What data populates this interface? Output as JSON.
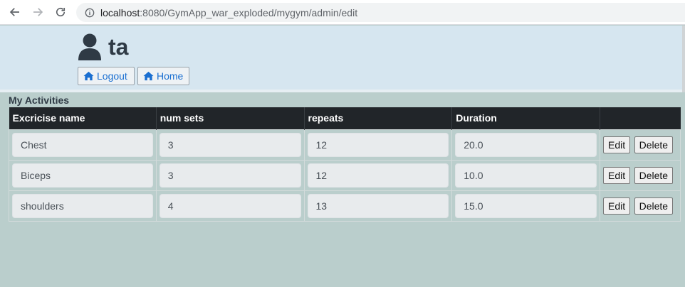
{
  "browser": {
    "url_host": "localhost",
    "url_rest": ":8080/GymApp_war_exploded/mygym/admin/edit",
    "icons": {
      "back": "arrow-left-icon",
      "forward": "arrow-right-icon",
      "reload": "reload-icon",
      "info": "info-icon"
    }
  },
  "header": {
    "username": "ta",
    "user_icon": "user-icon",
    "logout_label": "Logout",
    "home_label": "Home",
    "button_icon": "home-icon",
    "button_text_color": "#1a6fd1"
  },
  "activities": {
    "title": "My Activities",
    "columns": [
      "Excricise name",
      "num sets",
      "repeats",
      "Duration",
      ""
    ],
    "rows": [
      {
        "name": "Chest",
        "sets": "3",
        "repeats": "12",
        "duration": "20.0"
      },
      {
        "name": "Biceps",
        "sets": "3",
        "repeats": "12",
        "duration": "10.0"
      },
      {
        "name": "shoulders",
        "sets": "4",
        "repeats": "13",
        "duration": "15.0"
      }
    ],
    "edit_label": "Edit",
    "delete_label": "Delete"
  }
}
